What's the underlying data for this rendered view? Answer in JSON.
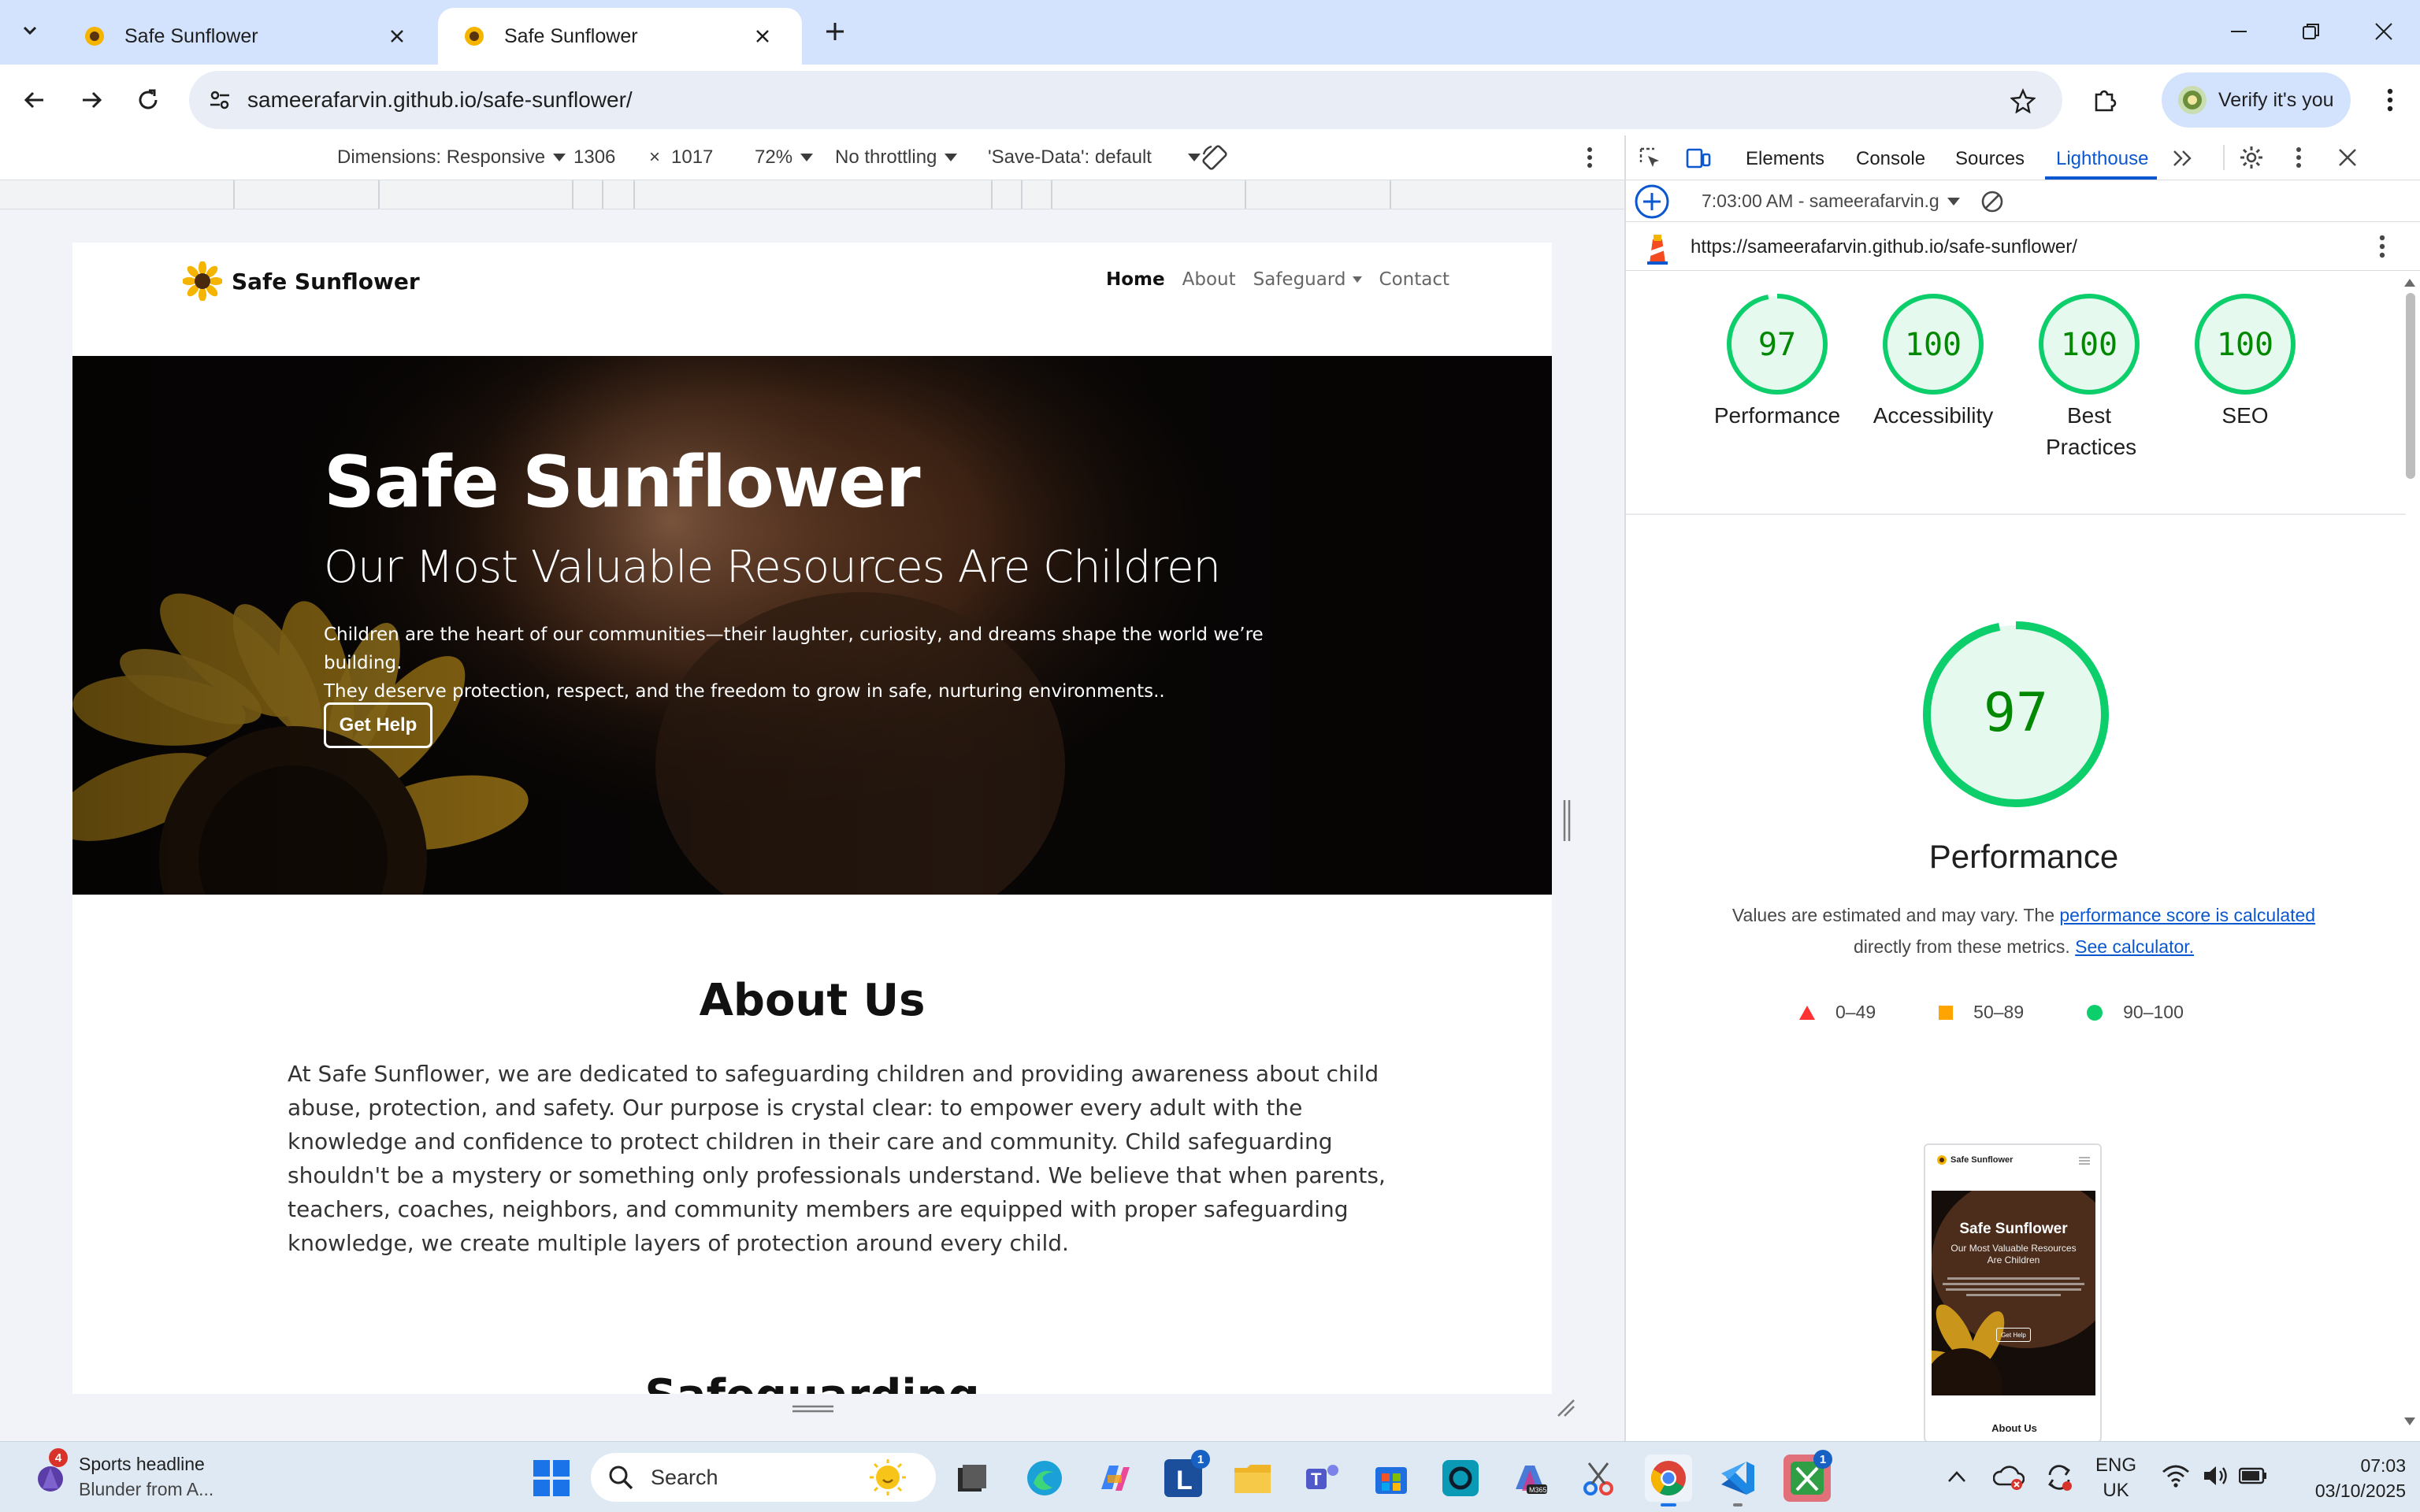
{
  "browser": {
    "tabs": [
      {
        "title": "Safe Sunflower"
      },
      {
        "title": "Safe Sunflower"
      }
    ],
    "url": "sameerafarvin.github.io/safe-sunflower/",
    "verify_label": "Verify it's you"
  },
  "device_toolbar": {
    "dimensions_label": "Dimensions: Responsive",
    "width": "1306",
    "times": "×",
    "height": "1017",
    "zoom": "72%",
    "throttling": "No throttling",
    "save_data": "'Save-Data': default"
  },
  "site": {
    "brand": "Safe Sunflower",
    "nav": [
      "Home",
      "About",
      "Safeguard",
      "Contact"
    ],
    "hero_title": "Safe Sunflower",
    "hero_subtitle": "Our Most Valuable Resources Are Children",
    "hero_desc_1": "Children are the heart of our communities—their laughter, curiosity, and dreams shape the world we’re building.",
    "hero_desc_2": "They deserve protection, respect, and the freedom to grow in safe, nurturing environments..",
    "hero_button": "Get Help",
    "about_title": "About Us",
    "about_text": "At Safe Sunflower, we are dedicated to safeguarding children and providing awareness about child abuse, protection, and safety. Our purpose is crystal clear: to empower every adult with the knowledge and confidence to protect children in their care and community. Child safeguarding shouldn't be a mystery or something only professionals understand. We believe that when parents, teachers, coaches, neighbors, and community members are equipped with proper safeguarding knowledge, we create multiple layers of protection around every child.",
    "next_title_partial": "Safeguarding"
  },
  "devtools": {
    "tabs": [
      "Elements",
      "Console",
      "Sources",
      "Lighthouse"
    ],
    "active_tab": "Lighthouse",
    "report_selector": "7:03:00 AM - sameerafarvin.g",
    "report_url": "https://sameerafarvin.github.io/safe-sunflower/",
    "scores": [
      {
        "label": "Performance",
        "value": 97
      },
      {
        "label": "Accessibility",
        "value": 100
      },
      {
        "label": "Best Practices",
        "value": 100
      },
      {
        "label": "SEO",
        "value": 100
      }
    ],
    "big_score": 97,
    "big_label": "Performance",
    "note_1": "Values are estimated and may vary. The ",
    "note_link_1": "performance score is calculated",
    "note_2": "directly from these metrics. ",
    "note_link_2": "See calculator.",
    "legend": [
      "0–49",
      "50–89",
      "90–100"
    ],
    "colors": {
      "fail": "#ff3333",
      "average": "#ffa400",
      "pass": "#0cce6b",
      "pass_fill": "#e6f9ef",
      "pass_text": "#008800"
    },
    "thumb": {
      "brand": "Safe Sunflower",
      "title": "Safe Sunflower",
      "subtitle": "Our Most Valuable Resources Are Children",
      "button": "Get Help",
      "about": "About Us"
    }
  },
  "taskbar": {
    "news_badge": "4",
    "news_title": "Sports headline",
    "news_sub": "Blunder from A...",
    "search": "Search",
    "lang_1": "ENG",
    "lang_2": "UK",
    "time": "07:03",
    "date": "03/10/2025",
    "l_badge": "1",
    "xbox_badge": "1"
  }
}
